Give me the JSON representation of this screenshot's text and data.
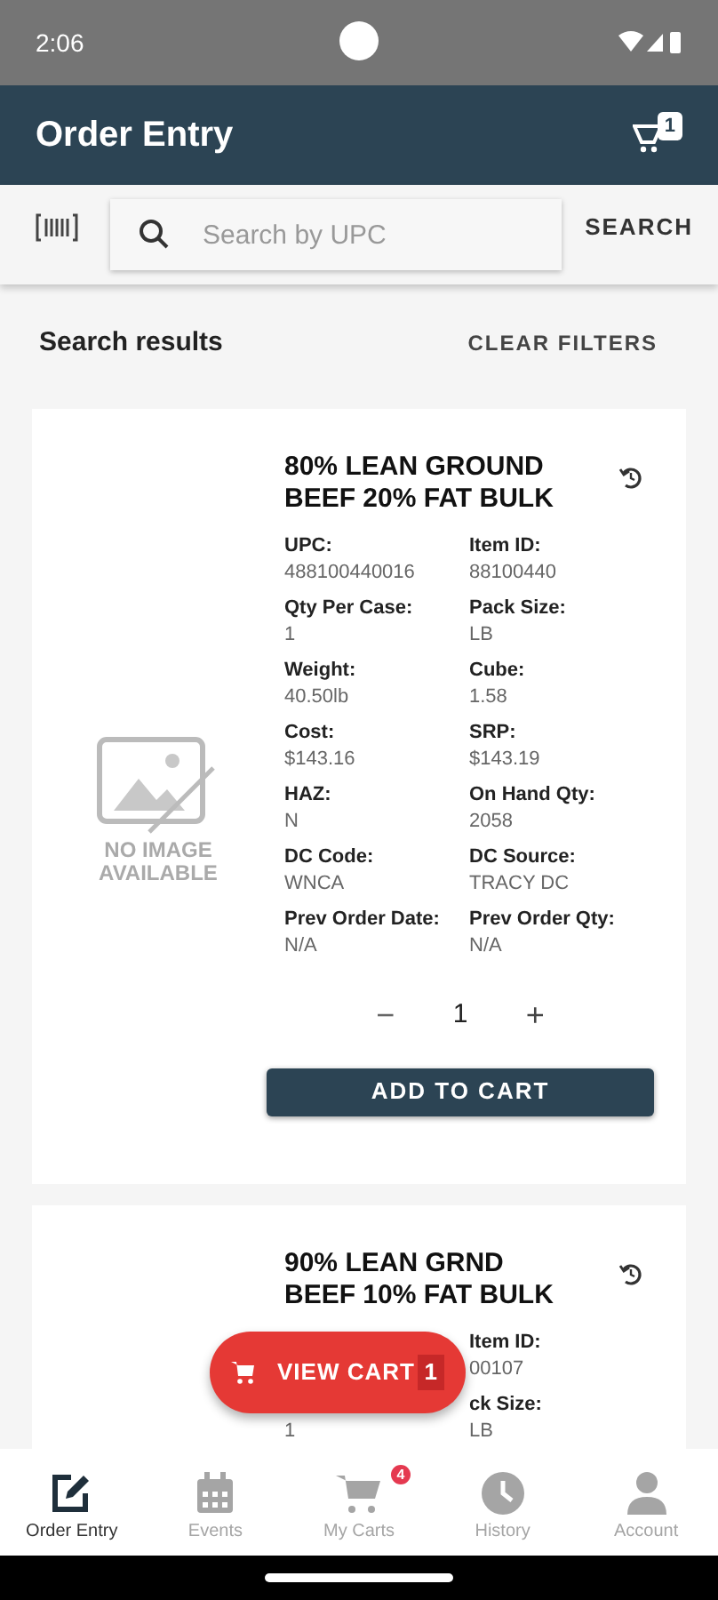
{
  "status_bar": {
    "time": "2:06"
  },
  "app_bar": {
    "title": "Order Entry",
    "cart_count": "1"
  },
  "search": {
    "placeholder": "Search by UPC",
    "button": "SEARCH"
  },
  "results_header": {
    "title": "Search results",
    "clear": "CLEAR FILTERS"
  },
  "products": [
    {
      "image": {
        "text": "NO IMAGE AVAILABLE"
      },
      "title": "80% LEAN GROUND BEEF 20% FAT BULK",
      "fields": [
        {
          "label": "UPC:",
          "value": "488100440016"
        },
        {
          "label": "Item ID:",
          "value": "88100440"
        },
        {
          "label": "Qty Per Case:",
          "value": "1"
        },
        {
          "label": "Pack Size:",
          "value": "LB"
        },
        {
          "label": "Weight:",
          "value": "40.50lb"
        },
        {
          "label": "Cube:",
          "value": "1.58"
        },
        {
          "label": "Cost:",
          "value": "$143.16"
        },
        {
          "label": "SRP:",
          "value": "$143.19"
        },
        {
          "label": "HAZ:",
          "value": "N"
        },
        {
          "label": "On Hand Qty:",
          "value": "2058"
        },
        {
          "label": "DC Code:",
          "value": "WNCA"
        },
        {
          "label": "DC Source:",
          "value": "TRACY DC"
        },
        {
          "label": "Prev Order Date:",
          "value": "N/A"
        },
        {
          "label": "Prev Order Qty:",
          "value": "N/A"
        }
      ],
      "quantity": {
        "minus": "−",
        "value": "1",
        "plus": "+"
      },
      "add_button": "ADD TO CART"
    },
    {
      "title": "90% LEAN GRND BEEF 10% FAT BULK",
      "rows": [
        {
          "right": {
            "label": "Item ID:",
            "value": "00107"
          }
        },
        {
          "left": {
            "value": "1"
          },
          "right": {
            "label": "ck Size:",
            "value": "LB"
          }
        }
      ]
    }
  ],
  "view_cart": {
    "label": "VIEW CART",
    "count": "1"
  },
  "bottom_nav": [
    {
      "kind": "edit",
      "label": "Order Entry",
      "selected": true
    },
    {
      "kind": "calendar",
      "label": "Events",
      "selected": false
    },
    {
      "kind": "cart",
      "label": "My Carts",
      "selected": false,
      "badge": "4"
    },
    {
      "kind": "clock",
      "label": "History",
      "selected": false
    },
    {
      "kind": "person",
      "label": "Account",
      "selected": false
    }
  ]
}
